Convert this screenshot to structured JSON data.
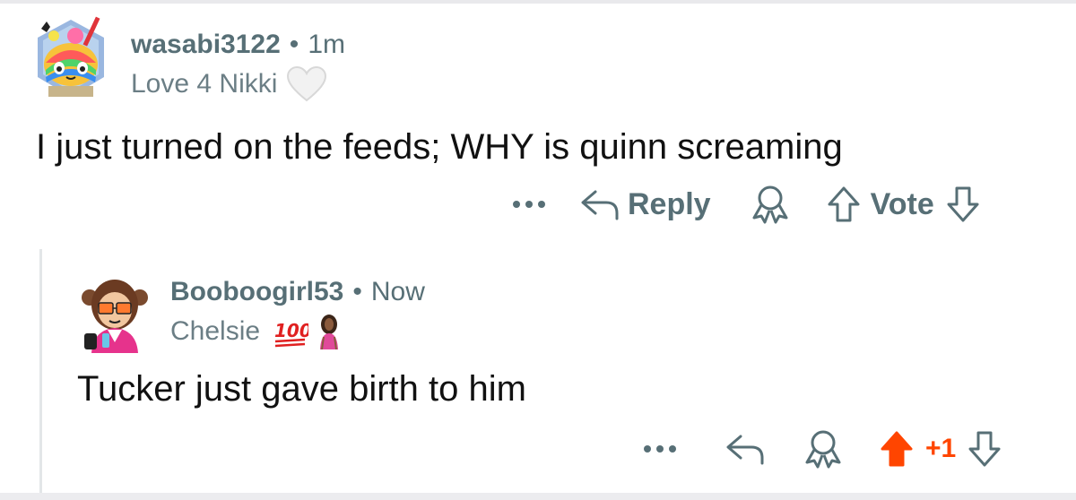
{
  "comments": [
    {
      "username": "wasabi3122",
      "separator": "•",
      "time": "1m",
      "flair": "Love 4 Nikki",
      "flair_emoji": "🤍",
      "body": "I just turned on the feeds; WHY is quinn screaming",
      "actions": {
        "more": "•••",
        "reply": "Reply",
        "vote": "Vote"
      }
    },
    {
      "username": "Booboogirl53",
      "separator": "•",
      "time": "Now",
      "flair": "Chelsie",
      "flair_emoji": "💯",
      "body": "Tucker just gave birth to him",
      "actions": {
        "more": "•••",
        "score": "+1"
      }
    }
  ],
  "colors": {
    "meta": "#576f76",
    "upvote_active": "#ff4500",
    "text": "#111111"
  },
  "icons": [
    "avatar-wasabi3122",
    "avatar-booboogirl53",
    "reply-arrow-icon",
    "award-icon",
    "upvote-icon",
    "downvote-icon",
    "more-dots-icon",
    "flair-person-icon"
  ]
}
